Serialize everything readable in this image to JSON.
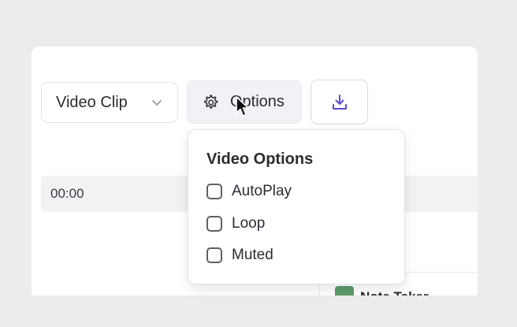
{
  "toolbar": {
    "media_select": {
      "value": "Video Clip",
      "icon": "chevron-down-icon"
    },
    "options_button": {
      "label": "Options",
      "icon": "gear-icon"
    },
    "download_button": {
      "icon": "download-icon",
      "color": "#5b4bd6"
    }
  },
  "timeline": {
    "time": "00:00"
  },
  "dropdown": {
    "title": "Video Options",
    "options": [
      {
        "label": "AutoPlay",
        "checked": false
      },
      {
        "label": "Loop",
        "checked": false
      },
      {
        "label": "Muted",
        "checked": false
      }
    ]
  },
  "note_card": {
    "title": "Note Taker"
  }
}
